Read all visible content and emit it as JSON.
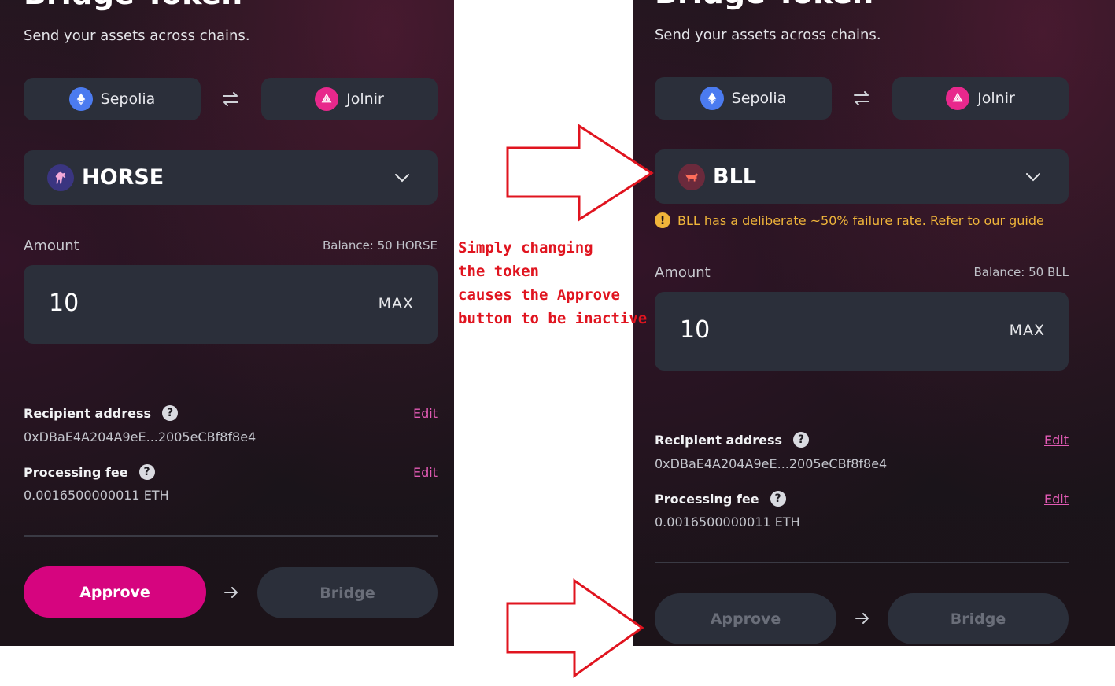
{
  "panel_left": {
    "title": "Bridge Token",
    "subtitle": "Send your assets across chains.",
    "from_chain": "Sepolia",
    "to_chain": "Jolnir",
    "token": "HORSE",
    "amount_label": "Amount",
    "balance": "Balance: 50 HORSE",
    "amount_value": "10",
    "max_label": "MAX",
    "recipient_label": "Recipient address",
    "recipient_value": "0xDBaE4A204A9eE...2005eCBf8f8e4",
    "fee_label": "Processing fee",
    "fee_value": "0.0016500000011 ETH",
    "edit_label": "Edit",
    "approve_label": "Approve",
    "bridge_label": "Bridge"
  },
  "panel_right": {
    "title": "Bridge Token",
    "subtitle": "Send your assets across chains.",
    "from_chain": "Sepolia",
    "to_chain": "Jolnir",
    "token": "BLL",
    "warning": "BLL has a deliberate ~50% failure rate. Refer to our guide",
    "amount_label": "Amount",
    "balance": "Balance: 50 BLL",
    "amount_value": "10",
    "max_label": "MAX",
    "recipient_label": "Recipient address",
    "recipient_value": "0xDBaE4A204A9eE...2005eCBf8f8e4",
    "fee_label": "Processing fee",
    "fee_value": "0.0016500000011 ETH",
    "edit_label": "Edit",
    "approve_label": "Approve",
    "bridge_label": "Bridge"
  },
  "annotation": {
    "lines": [
      "Simply changing",
      "the token",
      "causes the Approve",
      "button to be inactive"
    ]
  },
  "colors": {
    "accent": "#d6057f",
    "annotation": "#e0141f",
    "warning": "#f0b53a",
    "edit_link": "#e35bb5"
  },
  "icons": [
    "ethereum-icon",
    "jolnir-icon",
    "swap-icon",
    "horse-token-icon",
    "bull-token-icon",
    "chevron-down-icon",
    "help-icon",
    "warning-icon",
    "arrow-right-icon"
  ]
}
